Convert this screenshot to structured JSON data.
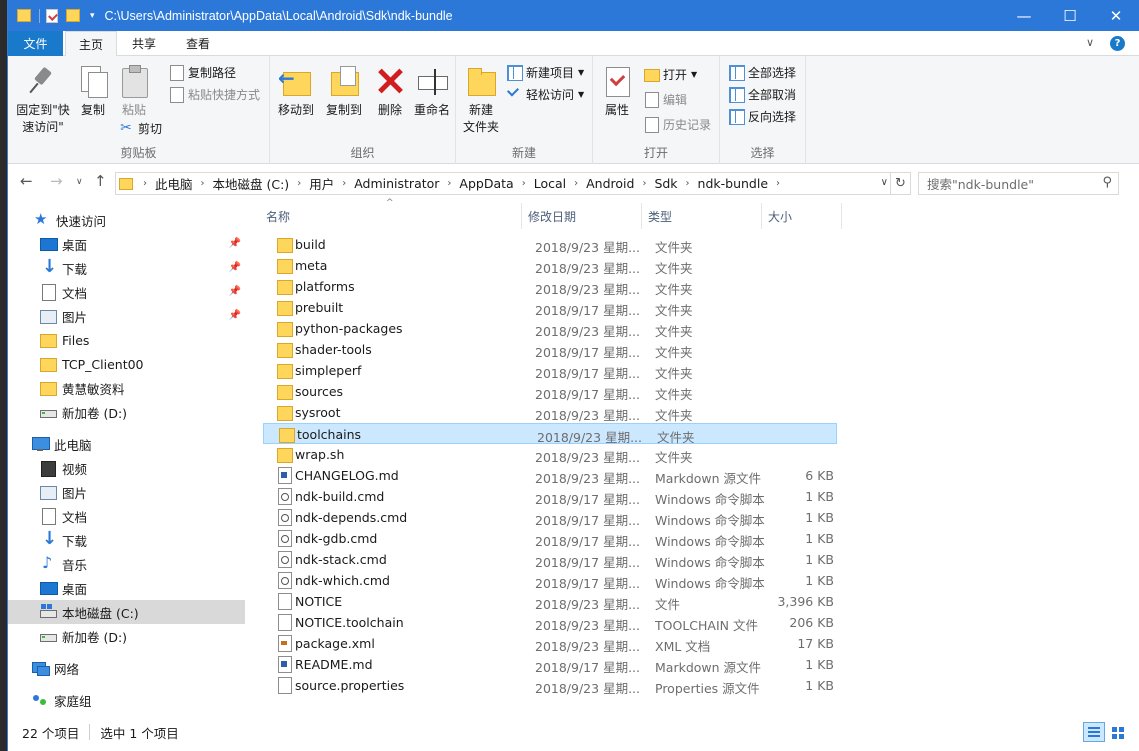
{
  "window": {
    "title_path": "C:\\Users\\Administrator\\AppData\\Local\\Android\\Sdk\\ndk-bundle",
    "minimize": "—",
    "maximize": "☐",
    "close": "✕",
    "accent": "#2b78d8"
  },
  "ribbon_tabs": {
    "file": "文件",
    "home": "主页",
    "share": "共享",
    "view": "查看",
    "collapse": "∨",
    "help": "?"
  },
  "ribbon": {
    "clipboard": {
      "label": "剪贴板",
      "pin": "固定到\"快速访问\"",
      "copy": "复制",
      "paste": "粘贴",
      "copy_path": "复制路径",
      "paste_shortcut": "粘贴快捷方式",
      "cut": "剪切"
    },
    "organize": {
      "label": "组织",
      "move_to": "移动到",
      "copy_to": "复制到",
      "delete": "删除",
      "rename": "重命名"
    },
    "new": {
      "label": "新建",
      "new_folder": "新建\n文件夹",
      "new_item": "新建项目",
      "easy_access": "轻松访问"
    },
    "open": {
      "label": "打开",
      "properties": "属性",
      "open": "打开",
      "edit": "编辑",
      "history": "历史记录"
    },
    "select": {
      "label": "选择",
      "select_all": "全部选择",
      "select_none": "全部取消",
      "invert": "反向选择"
    }
  },
  "address": {
    "crumbs": [
      "此电脑",
      "本地磁盘 (C:)",
      "用户",
      "Administrator",
      "AppData",
      "Local",
      "Android",
      "Sdk",
      "ndk-bundle"
    ],
    "search_placeholder": "搜索\"ndk-bundle\""
  },
  "nav": {
    "quick_access": "快速访问",
    "items": [
      {
        "label": "桌面",
        "icon": "desktop-icon",
        "pinned": true
      },
      {
        "label": "下载",
        "icon": "download-icon",
        "pinned": true
      },
      {
        "label": "文档",
        "icon": "document-icon",
        "pinned": true
      },
      {
        "label": "图片",
        "icon": "picture-icon",
        "pinned": true
      },
      {
        "label": "Files",
        "icon": "folder-icon",
        "pinned": false
      },
      {
        "label": "TCP_Client00",
        "icon": "folder-icon",
        "pinned": false
      },
      {
        "label": "黄慧敏资料",
        "icon": "folder-icon",
        "pinned": false
      },
      {
        "label": "新加卷 (D:)",
        "icon": "drive-icon",
        "pinned": false
      }
    ],
    "this_pc": "此电脑",
    "pc_items": [
      {
        "label": "视频",
        "icon": "video-icon"
      },
      {
        "label": "图片",
        "icon": "picture-icon"
      },
      {
        "label": "文档",
        "icon": "document-icon"
      },
      {
        "label": "下载",
        "icon": "download-icon"
      },
      {
        "label": "音乐",
        "icon": "music-icon"
      },
      {
        "label": "桌面",
        "icon": "desktop-icon"
      },
      {
        "label": "本地磁盘 (C:)",
        "icon": "system-drive-icon",
        "selected": true
      },
      {
        "label": "新加卷 (D:)",
        "icon": "drive-icon"
      }
    ],
    "network": "网络",
    "homegroup": "家庭组"
  },
  "columns": {
    "name": "名称",
    "date": "修改日期",
    "type": "类型",
    "size": "大小"
  },
  "files": [
    {
      "name": "build",
      "date": "2018/9/23 星期...",
      "type": "文件夹",
      "size": "",
      "icon": "folder"
    },
    {
      "name": "meta",
      "date": "2018/9/23 星期...",
      "type": "文件夹",
      "size": "",
      "icon": "folder"
    },
    {
      "name": "platforms",
      "date": "2018/9/23 星期...",
      "type": "文件夹",
      "size": "",
      "icon": "folder"
    },
    {
      "name": "prebuilt",
      "date": "2018/9/17 星期...",
      "type": "文件夹",
      "size": "",
      "icon": "folder"
    },
    {
      "name": "python-packages",
      "date": "2018/9/23 星期...",
      "type": "文件夹",
      "size": "",
      "icon": "folder"
    },
    {
      "name": "shader-tools",
      "date": "2018/9/17 星期...",
      "type": "文件夹",
      "size": "",
      "icon": "folder"
    },
    {
      "name": "simpleperf",
      "date": "2018/9/17 星期...",
      "type": "文件夹",
      "size": "",
      "icon": "folder"
    },
    {
      "name": "sources",
      "date": "2018/9/17 星期...",
      "type": "文件夹",
      "size": "",
      "icon": "folder"
    },
    {
      "name": "sysroot",
      "date": "2018/9/23 星期...",
      "type": "文件夹",
      "size": "",
      "icon": "folder"
    },
    {
      "name": "toolchains",
      "date": "2018/9/23 星期...",
      "type": "文件夹",
      "size": "",
      "icon": "folder",
      "selected": true
    },
    {
      "name": "wrap.sh",
      "date": "2018/9/23 星期...",
      "type": "文件夹",
      "size": "",
      "icon": "folder"
    },
    {
      "name": "CHANGELOG.md",
      "date": "2018/9/23 星期...",
      "type": "Markdown 源文件",
      "size": "6 KB",
      "icon": "md"
    },
    {
      "name": "ndk-build.cmd",
      "date": "2018/9/17 星期...",
      "type": "Windows 命令脚本",
      "size": "1 KB",
      "icon": "cmd"
    },
    {
      "name": "ndk-depends.cmd",
      "date": "2018/9/17 星期...",
      "type": "Windows 命令脚本",
      "size": "1 KB",
      "icon": "cmd"
    },
    {
      "name": "ndk-gdb.cmd",
      "date": "2018/9/17 星期...",
      "type": "Windows 命令脚本",
      "size": "1 KB",
      "icon": "cmd"
    },
    {
      "name": "ndk-stack.cmd",
      "date": "2018/9/17 星期...",
      "type": "Windows 命令脚本",
      "size": "1 KB",
      "icon": "cmd"
    },
    {
      "name": "ndk-which.cmd",
      "date": "2018/9/17 星期...",
      "type": "Windows 命令脚本",
      "size": "1 KB",
      "icon": "cmd"
    },
    {
      "name": "NOTICE",
      "date": "2018/9/23 星期...",
      "type": "文件",
      "size": "3,396 KB",
      "icon": "file"
    },
    {
      "name": "NOTICE.toolchain",
      "date": "2018/9/23 星期...",
      "type": "TOOLCHAIN 文件",
      "size": "206 KB",
      "icon": "file"
    },
    {
      "name": "package.xml",
      "date": "2018/9/23 星期...",
      "type": "XML 文档",
      "size": "17 KB",
      "icon": "xml"
    },
    {
      "name": "README.md",
      "date": "2018/9/17 星期...",
      "type": "Markdown 源文件",
      "size": "1 KB",
      "icon": "md"
    },
    {
      "name": "source.properties",
      "date": "2018/9/23 星期...",
      "type": "Properties 源文件",
      "size": "1 KB",
      "icon": "file"
    }
  ],
  "status": {
    "count": "22 个项目",
    "selected": "选中 1 个项目"
  }
}
